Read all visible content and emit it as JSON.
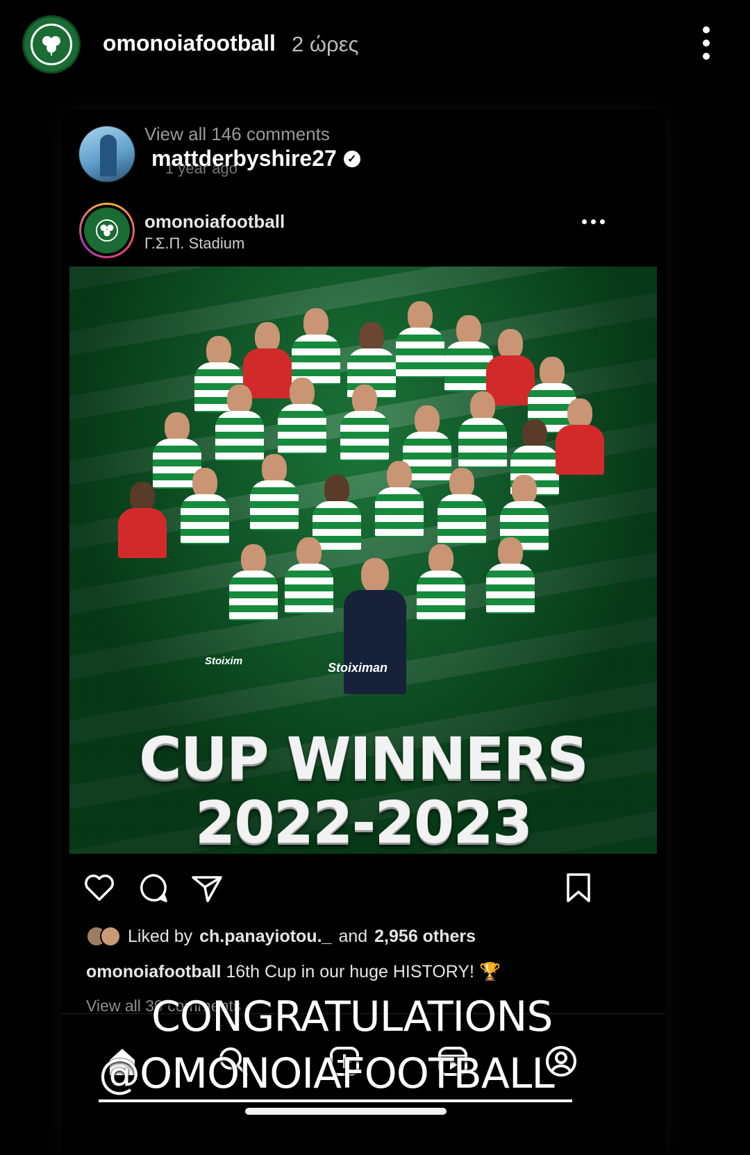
{
  "story": {
    "username": "omonoiafootball",
    "time": "2 ώρες"
  },
  "screenshot": {
    "comments_link": "View all 146 comments",
    "comment_age": "1 year ago",
    "reply_username": "mattderbyshire27",
    "post": {
      "username": "omonoiafootball",
      "location": "Γ.Σ.Π. Stadium",
      "poster": {
        "title_line1": "CUP WINNERS",
        "title_line2": "2022-2023",
        "sponsor": "Stoiximan",
        "sponsor_short": "Stoixim"
      },
      "likes": {
        "prefix": "Liked by",
        "user": "ch.panayiotou._",
        "middle": "and",
        "others": "2,956 others"
      },
      "caption": {
        "username": "omonoiafootball",
        "text": "16th Cup in our huge HISTORY! 🏆"
      },
      "view_comments": "View all 30 comments"
    }
  },
  "overlay": {
    "line1": "CONGRATULATIONS",
    "line2": "@OMONOIAFOOTBALL"
  },
  "colors": {
    "background": "#000000",
    "club_green": "#1b6b34",
    "secondary_text": "#bdbdbd"
  },
  "icons": [
    "more-vertical-icon",
    "verified-icon",
    "more-horizontal-icon",
    "heart-icon",
    "comment-icon",
    "share-icon",
    "bookmark-icon",
    "home-icon",
    "search-icon",
    "add-post-icon",
    "reels-icon",
    "profile-icon"
  ]
}
